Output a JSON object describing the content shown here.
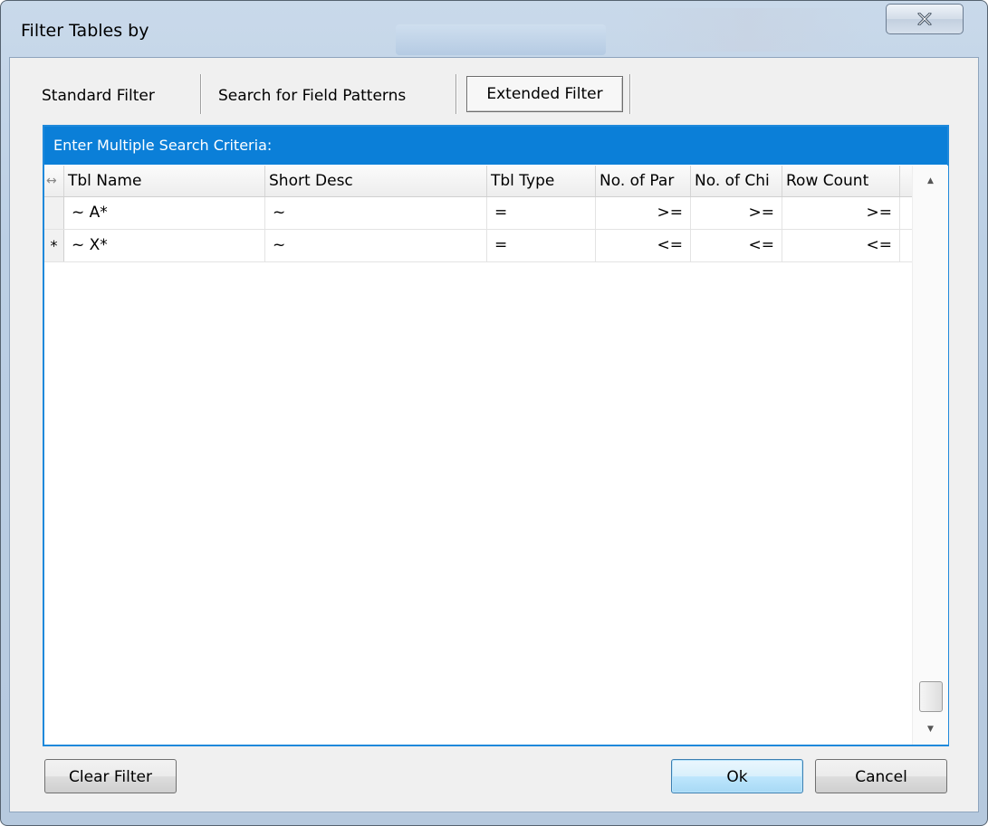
{
  "window": {
    "title": "Filter Tables by",
    "close_glyph": "✕"
  },
  "tabs": [
    {
      "label": "Standard Filter"
    },
    {
      "label": "Search for Field Patterns"
    },
    {
      "label": "Extended Filter",
      "active": true
    }
  ],
  "grid": {
    "caption": "Enter Multiple Search Criteria:",
    "resize_glyph": "↔",
    "columns": [
      "Tbl Name",
      "Short Desc",
      "Tbl Type",
      "No. of Par",
      "No. of Chi",
      "Row Count"
    ],
    "rows": [
      {
        "marker": "",
        "cells": [
          "~ A*",
          "~",
          "=",
          ">=",
          ">=",
          ">="
        ]
      },
      {
        "marker": "*",
        "cells": [
          "~ X*",
          "~",
          "=",
          "<=",
          "<=",
          "<="
        ]
      }
    ],
    "scroll_up_glyph": "▲",
    "scroll_down_glyph": "▼"
  },
  "buttons": {
    "clear_filter": "Clear Filter",
    "ok": "Ok",
    "cancel": "Cancel"
  },
  "colors": {
    "caption_bg": "#0b7fd8",
    "grid_border": "#1f89db"
  }
}
